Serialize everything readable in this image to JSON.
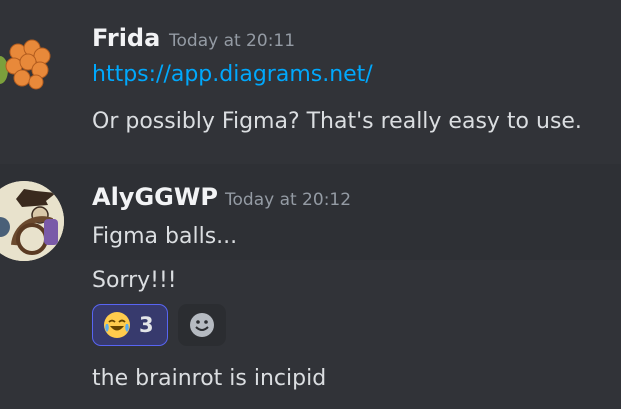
{
  "messages": [
    {
      "author": "Frida",
      "timestamp": "Today at 20:11",
      "link": "https://app.diagrams.net/",
      "text": "Or possibly Figma? That's really easy to use."
    },
    {
      "author": "AlyGGWP",
      "timestamp": "Today at 20:12",
      "lines": [
        "Figma balls...",
        "Sorry!!!"
      ],
      "reaction": {
        "emoji": "joy-emoji",
        "count": "3"
      },
      "after_reaction": "the brainrot is incipid"
    }
  ],
  "colors": {
    "background": "#313338",
    "link": "#00a8fc",
    "reaction_border": "#5865f2"
  }
}
